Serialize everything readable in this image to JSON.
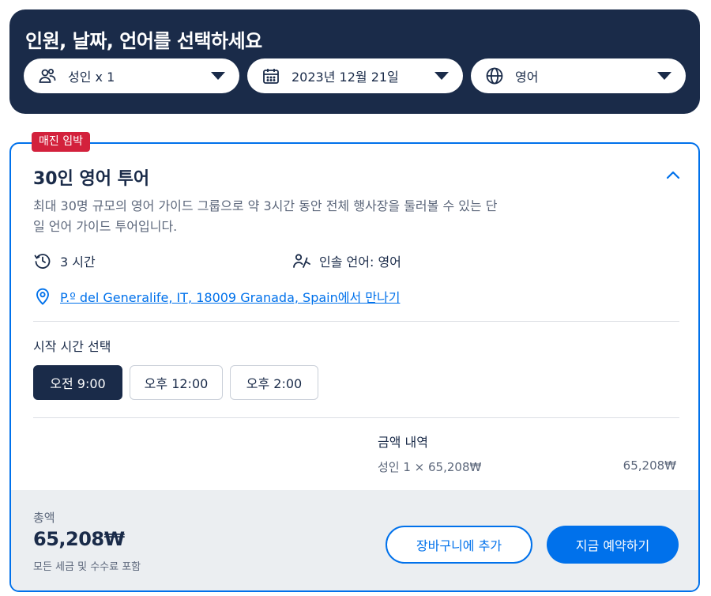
{
  "selector": {
    "title": "인원, 날짜, 언어를 선택하세요",
    "participants": {
      "label": "성인 x 1",
      "icon": "people-icon"
    },
    "date": {
      "label": "2023년 12월 21일",
      "icon": "calendar-icon"
    },
    "language": {
      "label": "영어",
      "icon": "globe-icon"
    }
  },
  "option": {
    "badge": "매진 임박",
    "title": "30인 영어 투어",
    "description": "최대 30명 규모의 영어 가이드 그룹으로 약 3시간 동안 전체 행사장을 둘러볼 수 있는 단일 언어 가이드 투어입니다.",
    "duration": "3 시간",
    "language_info": "인솔 언어: 영어",
    "meeting_point": {
      "link": "P.º del Generalife, IT, 18009 Granada, Spain",
      "suffix": "에서 만나기"
    },
    "start_time_label": "시작 시간 선택",
    "times": [
      {
        "label": "오전 9:00",
        "selected": true
      },
      {
        "label": "오후 12:00",
        "selected": false
      },
      {
        "label": "오후 2:00",
        "selected": false
      }
    ],
    "price": {
      "heading": "금액 내역",
      "line_label": "성인 1 × 65,208₩",
      "line_value": "65,208₩"
    },
    "footer": {
      "total_label": "총액",
      "total_value": "65,208₩",
      "total_note": "모든 세금 및 수수료 포함",
      "cart_button": "장바구니에 추가",
      "book_button": "지금 예약하기"
    }
  },
  "colors": {
    "navy": "#1a2b49",
    "accent": "#0071eb",
    "badge": "#d3213c",
    "footer_bg": "#ebeef1"
  }
}
